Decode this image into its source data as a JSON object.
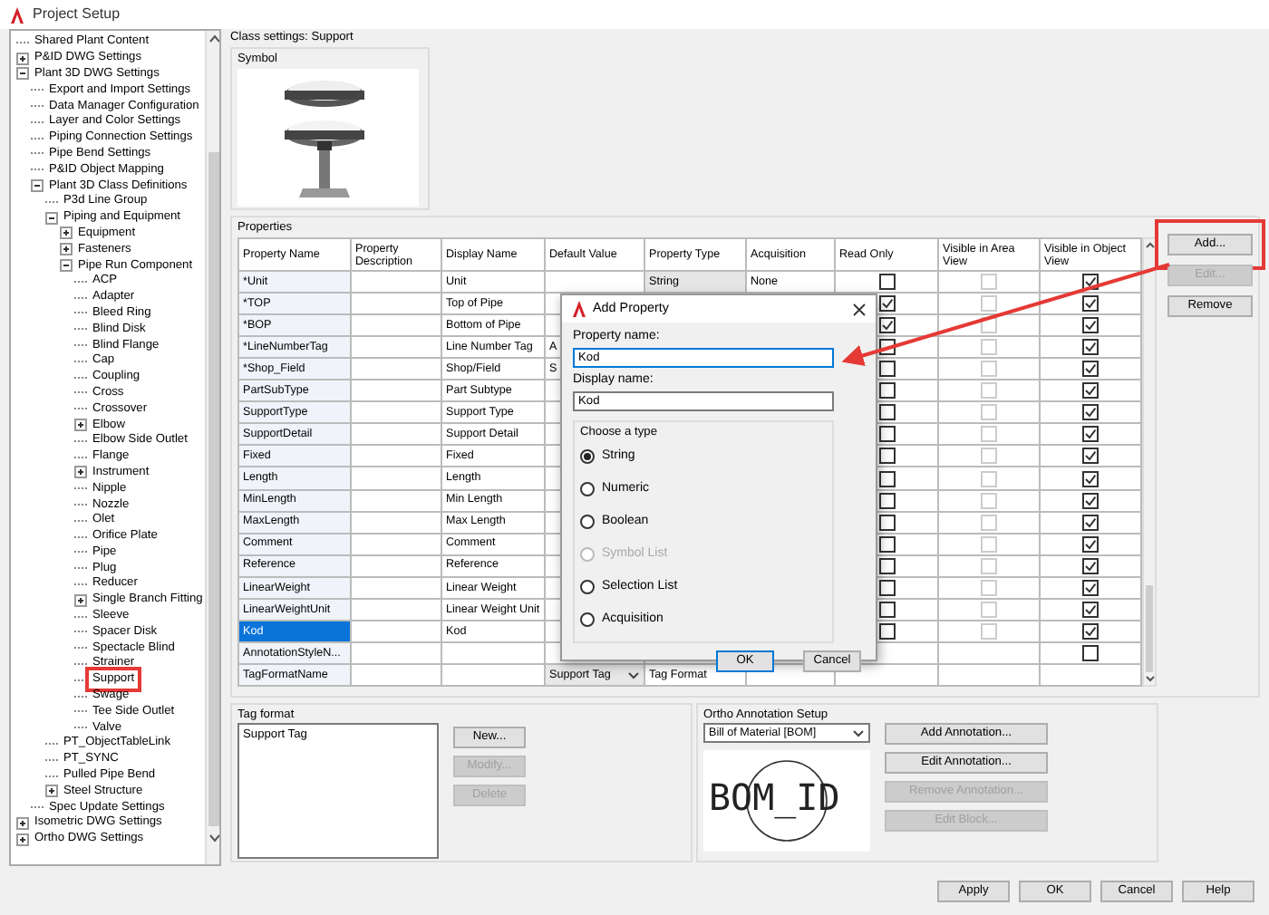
{
  "window": {
    "title": "Project Setup"
  },
  "tree": [
    {
      "label": "Shared Plant Content",
      "kind": "leaf"
    },
    {
      "label": "P&ID DWG Settings",
      "kind": "folder",
      "expanded": false
    },
    {
      "label": "Plant 3D DWG Settings",
      "kind": "folder",
      "expanded": true,
      "children": [
        {
          "label": "Export and Import Settings",
          "kind": "leaf"
        },
        {
          "label": "Data Manager Configuration",
          "kind": "leaf"
        },
        {
          "label": "Layer and Color Settings",
          "kind": "leaf"
        },
        {
          "label": "Piping Connection Settings",
          "kind": "leaf"
        },
        {
          "label": "Pipe Bend Settings",
          "kind": "leaf"
        },
        {
          "label": "P&ID Object Mapping",
          "kind": "leaf"
        },
        {
          "label": "Plant 3D Class Definitions",
          "kind": "folder",
          "expanded": true,
          "children": [
            {
              "label": "P3d Line Group",
              "kind": "leaf"
            },
            {
              "label": "Piping and Equipment",
              "kind": "folder",
              "expanded": true,
              "children": [
                {
                  "label": "Equipment",
                  "kind": "folder",
                  "expanded": false
                },
                {
                  "label": "Fasteners",
                  "kind": "folder",
                  "expanded": false
                },
                {
                  "label": "Pipe Run Component",
                  "kind": "folder",
                  "expanded": true,
                  "children": [
                    {
                      "label": "ACP",
                      "kind": "leaf"
                    },
                    {
                      "label": "Adapter",
                      "kind": "leaf"
                    },
                    {
                      "label": "Bleed Ring",
                      "kind": "leaf"
                    },
                    {
                      "label": "Blind Disk",
                      "kind": "leaf"
                    },
                    {
                      "label": "Blind Flange",
                      "kind": "leaf"
                    },
                    {
                      "label": "Cap",
                      "kind": "leaf"
                    },
                    {
                      "label": "Coupling",
                      "kind": "leaf"
                    },
                    {
                      "label": "Cross",
                      "kind": "leaf"
                    },
                    {
                      "label": "Crossover",
                      "kind": "leaf"
                    },
                    {
                      "label": "Elbow",
                      "kind": "folder",
                      "expanded": false
                    },
                    {
                      "label": "Elbow Side Outlet",
                      "kind": "leaf"
                    },
                    {
                      "label": "Flange",
                      "kind": "leaf"
                    },
                    {
                      "label": "Instrument",
                      "kind": "folder",
                      "expanded": false
                    },
                    {
                      "label": "Nipple",
                      "kind": "leaf"
                    },
                    {
                      "label": "Nozzle",
                      "kind": "leaf"
                    },
                    {
                      "label": "Olet",
                      "kind": "leaf"
                    },
                    {
                      "label": "Orifice Plate",
                      "kind": "leaf"
                    },
                    {
                      "label": "Pipe",
                      "kind": "leaf"
                    },
                    {
                      "label": "Plug",
                      "kind": "leaf"
                    },
                    {
                      "label": "Reducer",
                      "kind": "leaf"
                    },
                    {
                      "label": "Single Branch Fitting",
                      "kind": "folder",
                      "expanded": false
                    },
                    {
                      "label": "Sleeve",
                      "kind": "leaf"
                    },
                    {
                      "label": "Spacer Disk",
                      "kind": "leaf"
                    },
                    {
                      "label": "Spectacle Blind",
                      "kind": "leaf"
                    },
                    {
                      "label": "Strainer",
                      "kind": "leaf"
                    },
                    {
                      "label": "Support",
                      "kind": "leaf",
                      "highlighted": true
                    },
                    {
                      "label": "Swage",
                      "kind": "leaf"
                    },
                    {
                      "label": "Tee Side Outlet",
                      "kind": "leaf"
                    },
                    {
                      "label": "Valve",
                      "kind": "leaf"
                    }
                  ]
                }
              ]
            },
            {
              "label": "PT_ObjectTableLink",
              "kind": "leaf"
            },
            {
              "label": "PT_SYNC",
              "kind": "leaf"
            },
            {
              "label": "Pulled Pipe Bend",
              "kind": "leaf"
            },
            {
              "label": "Steel Structure",
              "kind": "folder",
              "expanded": false
            }
          ]
        },
        {
          "label": "Spec Update Settings",
          "kind": "leaf"
        }
      ]
    },
    {
      "label": "Isometric DWG Settings",
      "kind": "folder",
      "expanded": false
    },
    {
      "label": "Ortho DWG Settings",
      "kind": "folder",
      "expanded": false
    }
  ],
  "class_settings_title": "Class settings: Support",
  "symbol": {
    "title": "Symbol"
  },
  "properties": {
    "title": "Properties",
    "area_view_enabled": false,
    "columns": [
      "Property Name",
      "Property Description",
      "Display Name",
      "Default Value",
      "Property Type",
      "Acquisition",
      "Read Only",
      "Visible in Area View",
      "Visible in Object View"
    ],
    "rows": [
      {
        "name": "*Unit",
        "display_name": "Unit",
        "property_type": "String",
        "acquisition": "None",
        "read_only": false,
        "visible_in_area_view": false,
        "visible_in_object_view": true,
        "selected": false
      },
      {
        "name": "*TOP",
        "display_name": "Top of Pipe",
        "read_only": true,
        "visible_in_area_view": false,
        "visible_in_object_view": true,
        "selected": false
      },
      {
        "name": "*BOP",
        "display_name": "Bottom of Pipe",
        "read_only": true,
        "visible_in_area_view": false,
        "visible_in_object_view": true,
        "selected": false
      },
      {
        "name": "*LineNumberTag",
        "display_name": "Line Number Tag",
        "default_value": "A",
        "read_only": false,
        "visible_in_area_view": false,
        "visible_in_object_view": true,
        "selected": false
      },
      {
        "name": "*Shop_Field",
        "display_name": "Shop/Field",
        "default_value": "S",
        "read_only": false,
        "visible_in_area_view": false,
        "visible_in_object_view": true,
        "selected": false
      },
      {
        "name": "PartSubType",
        "display_name": "Part Subtype",
        "read_only": false,
        "visible_in_area_view": false,
        "visible_in_object_view": true,
        "selected": false
      },
      {
        "name": "SupportType",
        "display_name": "Support Type",
        "read_only": false,
        "visible_in_area_view": false,
        "visible_in_object_view": true,
        "selected": false
      },
      {
        "name": "SupportDetail",
        "display_name": "Support Detail",
        "read_only": false,
        "visible_in_area_view": false,
        "visible_in_object_view": true,
        "selected": false
      },
      {
        "name": "Fixed",
        "display_name": "Fixed",
        "read_only": false,
        "visible_in_area_view": false,
        "visible_in_object_view": true,
        "selected": false
      },
      {
        "name": "Length",
        "display_name": "Length",
        "read_only": false,
        "visible_in_area_view": false,
        "visible_in_object_view": true,
        "selected": false
      },
      {
        "name": "MinLength",
        "display_name": "Min Length",
        "read_only": false,
        "visible_in_area_view": false,
        "visible_in_object_view": true,
        "selected": false
      },
      {
        "name": "MaxLength",
        "display_name": "Max Length",
        "read_only": false,
        "visible_in_area_view": false,
        "visible_in_object_view": true,
        "selected": false
      },
      {
        "name": "Comment",
        "display_name": "Comment",
        "read_only": false,
        "visible_in_area_view": false,
        "visible_in_object_view": true,
        "selected": false
      },
      {
        "name": "Reference",
        "display_name": "Reference",
        "read_only": false,
        "visible_in_area_view": false,
        "visible_in_object_view": true,
        "selected": false
      },
      {
        "name": "LinearWeight",
        "display_name": "Linear Weight",
        "read_only": false,
        "visible_in_area_view": false,
        "visible_in_object_view": true,
        "selected": false
      },
      {
        "name": "LinearWeightUnit",
        "display_name": "Linear Weight Unit",
        "read_only": false,
        "visible_in_area_view": false,
        "visible_in_object_view": true,
        "selected": false
      },
      {
        "name": "Kod",
        "display_name": "Kod",
        "read_only": false,
        "visible_in_area_view": false,
        "visible_in_object_view": true,
        "selected": true
      },
      {
        "name": "AnnotationStyleN...",
        "visible_in_object_view": false,
        "selected": false
      },
      {
        "name": "TagFormatName",
        "default_value": "Support Tag",
        "default_dropdown": true,
        "property_type": "Tag Format",
        "selected": false
      }
    ]
  },
  "property_buttons": [
    {
      "label": "Add...",
      "disabled": false,
      "highlighted": true
    },
    {
      "label": "Edit...",
      "disabled": true,
      "highlighted": false
    },
    {
      "label": "Remove",
      "disabled": false,
      "highlighted": false
    }
  ],
  "add_property_dialog": {
    "title": "Add Property",
    "property_name_label": "Property name:",
    "property_name": "Kod",
    "property_name_focused": true,
    "display_name_label": "Display name:",
    "display_name": "Kod",
    "type_group_title": "Choose a type",
    "types": [
      {
        "label": "String",
        "selected": true,
        "disabled": false
      },
      {
        "label": "Numeric",
        "selected": false,
        "disabled": false
      },
      {
        "label": "Boolean",
        "selected": false,
        "disabled": false
      },
      {
        "label": "Symbol List",
        "selected": false,
        "disabled": true
      },
      {
        "label": "Selection List",
        "selected": false,
        "disabled": false
      },
      {
        "label": "Acquisition",
        "selected": false,
        "disabled": false
      }
    ],
    "buttons": [
      {
        "label": "OK",
        "default": true
      },
      {
        "label": "Cancel",
        "default": false
      }
    ]
  },
  "tag_format": {
    "title": "Tag format",
    "items": [
      "Support Tag"
    ],
    "buttons": [
      {
        "label": "New...",
        "disabled": false
      },
      {
        "label": "Modify...",
        "disabled": true
      },
      {
        "label": "Delete",
        "disabled": true
      }
    ]
  },
  "ortho_annotation": {
    "title": "Ortho Annotation Setup",
    "selected_option": "Bill of Material [BOM]",
    "preview_text": "BOM_ID",
    "buttons": [
      {
        "label": "Add Annotation...",
        "disabled": false
      },
      {
        "label": "Edit Annotation...",
        "disabled": false
      },
      {
        "label": "Remove Annotation...",
        "disabled": true
      },
      {
        "label": "Edit Block...",
        "disabled": true
      }
    ]
  },
  "footer_buttons": [
    {
      "label": "Apply"
    },
    {
      "label": "OK"
    },
    {
      "label": "Cancel"
    },
    {
      "label": "Help"
    }
  ]
}
